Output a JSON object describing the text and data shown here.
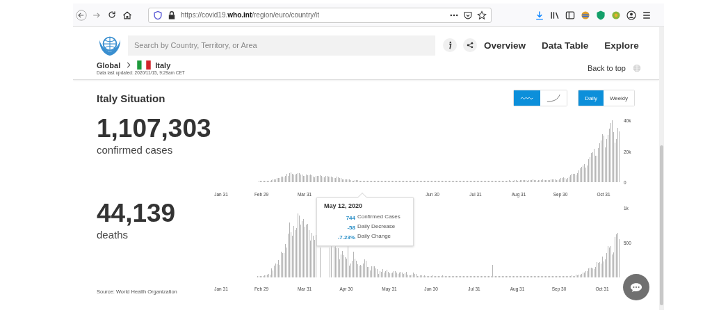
{
  "browser": {
    "url": "https://covid19.**who.int**/region/euro/country/it"
  },
  "header": {
    "search": {
      "placeholder": "Search by Country, Territory, or Area"
    },
    "nav": [
      {
        "label": "Overview"
      },
      {
        "label": "Data Table"
      },
      {
        "label": "Explore"
      }
    ],
    "breadcrumb": {
      "parent": "Global",
      "current": "Italy"
    },
    "updated": "Data last updated: 2020/11/15, 9:29am CET",
    "back_to_top": "Back to top"
  },
  "situation": {
    "title": "Italy Situation",
    "chart_type_toggle": [
      {
        "kind": "wave",
        "selected": true
      },
      {
        "kind": "curve",
        "selected": false
      }
    ],
    "period_toggle": [
      {
        "label": "Daily",
        "selected": true
      },
      {
        "label": "Weekly",
        "selected": false
      }
    ],
    "metrics": [
      {
        "value": "1,107,303",
        "label": "confirmed cases",
        "chart_data": {
          "type": "bar",
          "ylim": [
            0,
            40000
          ],
          "categories": [
            "Jan 31",
            null,
            null,
            null,
            null,
            null,
            null,
            null,
            null,
            null,
            null,
            null,
            null,
            null,
            null,
            null,
            null,
            null,
            null,
            null,
            null,
            null,
            null,
            null,
            null,
            null,
            null,
            null,
            null,
            "Feb 29",
            null,
            null,
            null,
            null,
            null,
            null,
            null,
            null,
            null,
            null,
            null,
            null,
            null,
            null,
            null,
            null,
            null,
            null,
            null,
            null,
            null,
            null,
            null,
            null,
            null,
            null,
            null,
            null,
            null,
            null,
            "Mar 31",
            null,
            null,
            null,
            null,
            null,
            null,
            null,
            null,
            null,
            null,
            null,
            null,
            null,
            null,
            null,
            null,
            null,
            null,
            null,
            null,
            null,
            null,
            null,
            null,
            null,
            null,
            null,
            null,
            null,
            null,
            null,
            null,
            null,
            null,
            null,
            null,
            null,
            null,
            null,
            null,
            null,
            null,
            null,
            null,
            null,
            null,
            null,
            null,
            null,
            null,
            null,
            null,
            null,
            null,
            null,
            null,
            null,
            null,
            null,
            null,
            null,
            null,
            null,
            null,
            null,
            null,
            null,
            null,
            null,
            null,
            null,
            null,
            null,
            null,
            null,
            null,
            null,
            null,
            null,
            null,
            null,
            null,
            null,
            null,
            null,
            null,
            null,
            null,
            null,
            null,
            null,
            "Jun 30",
            null,
            null,
            null,
            null,
            null,
            null,
            null,
            null,
            null,
            null,
            null,
            null,
            null,
            null,
            null,
            null,
            null,
            null,
            null,
            null,
            null,
            null,
            null,
            null,
            null,
            null,
            null,
            null,
            null,
            null,
            "Jul 31",
            null,
            null,
            null,
            null,
            null,
            null,
            null,
            null,
            null,
            null,
            null,
            null,
            null,
            null,
            null,
            null,
            null,
            null,
            null,
            null,
            null,
            null,
            null,
            null,
            null,
            null,
            null,
            null,
            null,
            null,
            "Aug 31",
            null,
            null,
            null,
            null,
            null,
            null,
            null,
            null,
            null,
            null,
            null,
            null,
            null,
            null,
            null,
            null,
            null,
            null,
            null,
            null,
            null,
            null,
            null,
            null,
            null,
            null,
            null,
            null,
            null,
            "Sep 30",
            null,
            null,
            null,
            null,
            null,
            null,
            null,
            null,
            null,
            null,
            null,
            null,
            null,
            null,
            null,
            null,
            null,
            null,
            null,
            null,
            null,
            null,
            null,
            null,
            null,
            null,
            null,
            null,
            null,
            null,
            "Oct 31",
            null,
            null,
            null,
            null,
            null,
            null,
            null,
            null,
            null,
            null,
            null
          ],
          "yticks": [
            {
              "value": 0,
              "label": "0"
            },
            {
              "value": 20000,
              "label": "20k"
            },
            {
              "value": 40000,
              "label": "40k"
            }
          ],
          "series": [
            {
              "color": "#b5b5b5",
              "values": [
                0,
                0,
                0,
                0,
                0,
                0,
                0,
                0,
                0,
                0,
                0,
                0,
                0,
                0,
                0,
                0,
                0,
                0,
                0,
                0,
                0,
                0,
                0,
                0,
                0,
                0,
                0,
                200,
                200,
                200,
                500,
                500,
                500,
                500,
                1000,
                1000,
                1500,
                2000,
                2000,
                2000,
                2500,
                2500,
                2500,
                3500,
                3500,
                3000,
                4000,
                5500,
                4000,
                6000,
                6500,
                5500,
                5000,
                5000,
                5500,
                6000,
                6000,
                5000,
                5000,
                4000,
                4000,
                5000,
                4500,
                4500,
                5000,
                4500,
                3500,
                3000,
                4000,
                4000,
                4000,
                4500,
                4000,
                3000,
                3000,
                4000,
                4000,
                3500,
                3500,
                3500,
                3000,
                2500,
                2500,
                3500,
                3000,
                2500,
                2500,
                2000,
                2000,
                2000,
                2000,
                2000,
                2000,
                1500,
                1000,
                1000,
                1500,
                1500,
                1500,
                1000,
                1000,
                1000,
                500,
                1000,
                1000,
                1000,
                1000,
                500,
                500,
                500,
                1000,
                500,
                500,
                500,
                500,
                500,
                500,
                500,
                500,
                500,
                500,
                500,
                200,
                200,
                200,
                500,
                500,
                200,
                200,
                200,
                200,
                200,
                500,
                200,
                500,
                200,
                200,
                500,
                200,
                500,
                200,
                200,
                200,
                200,
                200,
                200,
                200,
                200,
                200,
                200,
                200,
                200,
                200,
                200,
                200,
                200,
                200,
                200,
                200,
                200,
                200,
                200,
                200,
                200,
                200,
                200,
                200,
                200,
                200,
                200,
                200,
                200,
                200,
                200,
                200,
                200,
                200,
                200,
                200,
                200,
                200,
                500,
                500,
                500,
                200,
                200,
                200,
                500,
                500,
                500,
                500,
                500,
                200,
                500,
                500,
                500,
                500,
                500,
                500,
                500,
                500,
                1000,
                1000,
                1000,
                1000,
                1000,
                1000,
                1500,
                1000,
                1000,
                1000,
                1500,
                1500,
                1000,
                1000,
                1500,
                1500,
                1500,
                1500,
                1500,
                1000,
                1500,
                1500,
                1500,
                2000,
                1500,
                1500,
                1000,
                1500,
                1500,
                1500,
                2000,
                1500,
                1500,
                1500,
                1500,
                1500,
                2000,
                2000,
                2000,
                2000,
                1500,
                1500,
                2000,
                2500,
                2500,
                3000,
                2500,
                2000,
                2500,
                3500,
                4500,
                5500,
                5500,
                5500,
                4500,
                6000,
                7500,
                9000,
                10000,
                11000,
                11500,
                9500,
                11000,
                15000,
                16000,
                19000,
                19500,
                21500,
                17000,
                17000,
                22000,
                25000,
                27000,
                31000,
                30000,
                22500,
                28000,
                30500,
                34500,
                38000,
                40000,
                32500,
                25500,
                28000,
                35000,
                33000
              ]
            }
          ]
        }
      },
      {
        "value": "44,139",
        "label": "deaths",
        "chart_data": {
          "type": "bar",
          "ylim": [
            0,
            1000
          ],
          "categories": [
            "Jan 31",
            null,
            null,
            null,
            null,
            null,
            null,
            null,
            null,
            null,
            null,
            null,
            null,
            null,
            null,
            null,
            null,
            null,
            null,
            null,
            null,
            null,
            null,
            null,
            null,
            null,
            null,
            null,
            null,
            "Feb 29",
            null,
            null,
            null,
            null,
            null,
            null,
            null,
            null,
            null,
            null,
            null,
            null,
            null,
            null,
            null,
            null,
            null,
            null,
            null,
            null,
            null,
            null,
            null,
            null,
            null,
            null,
            null,
            null,
            null,
            null,
            "Mar 31",
            null,
            null,
            null,
            null,
            null,
            null,
            null,
            null,
            null,
            null,
            null,
            null,
            null,
            null,
            null,
            null,
            null,
            null,
            null,
            null,
            null,
            null,
            null,
            null,
            null,
            null,
            null,
            null,
            null,
            "Apr 30",
            null,
            null,
            null,
            null,
            null,
            null,
            null,
            null,
            null,
            null,
            null,
            null,
            null,
            null,
            null,
            null,
            null,
            null,
            null,
            null,
            null,
            null,
            null,
            null,
            null,
            null,
            null,
            null,
            null,
            null,
            "May 31",
            null,
            null,
            null,
            null,
            null,
            null,
            null,
            null,
            null,
            null,
            null,
            null,
            null,
            null,
            null,
            null,
            null,
            null,
            null,
            null,
            null,
            null,
            null,
            null,
            null,
            null,
            null,
            null,
            null,
            "Jun 30",
            null,
            null,
            null,
            null,
            null,
            null,
            null,
            null,
            null,
            null,
            null,
            null,
            null,
            null,
            null,
            null,
            null,
            null,
            null,
            null,
            null,
            null,
            null,
            null,
            null,
            null,
            null,
            null,
            null,
            null,
            "Jul 31",
            null,
            null,
            null,
            null,
            null,
            null,
            null,
            null,
            null,
            null,
            null,
            null,
            null,
            null,
            null,
            null,
            null,
            null,
            null,
            null,
            null,
            null,
            null,
            null,
            null,
            null,
            null,
            null,
            null,
            null,
            "Aug 31",
            null,
            null,
            null,
            null,
            null,
            null,
            null,
            null,
            null,
            null,
            null,
            null,
            null,
            null,
            null,
            null,
            null,
            null,
            null,
            null,
            null,
            null,
            null,
            null,
            null,
            null,
            null,
            null,
            null,
            "Sep 30",
            null,
            null,
            null,
            null,
            null,
            null,
            null,
            null,
            null,
            null,
            null,
            null,
            null,
            null,
            null,
            null,
            null,
            null,
            null,
            null,
            null,
            null,
            null,
            null,
            null,
            null,
            null,
            null,
            null,
            null,
            "Oct 31",
            null,
            null,
            null,
            null,
            null,
            null,
            null,
            null,
            null,
            null,
            null,
            null
          ],
          "yticks": [
            {
              "value": 500,
              "label": "500"
            },
            {
              "value": 1000,
              "label": "1k"
            }
          ],
          "series": [
            {
              "color": "#b5b5b5",
              "values": [
                0,
                0,
                0,
                0,
                0,
                0,
                0,
                0,
                0,
                0,
                0,
                0,
                0,
                0,
                0,
                0,
                0,
                0,
                0,
                0,
                0,
                0,
                0,
                0,
                0,
                0,
                10,
                10,
                10,
                10,
                10,
                30,
                30,
                40,
                50,
                40,
                130,
                100,
                170,
                200,
                190,
                250,
                180,
                370,
                350,
                350,
                480,
                430,
                630,
                790,
                650,
                600,
                740,
                680,
                710,
                920,
                890,
                760,
                810,
                840,
                730,
                760,
                770,
                680,
                530,
                640,
                600,
                540,
                610,
                null,
                null,
                430,
                null,
                null,
                null,
                null,
                null,
                null,
                430,
                450,
                null,
                440,
                460,
                420,
                420,
                260,
                330,
                380,
                320,
                290,
                270,
                470,
                170,
                200,
                240,
                370,
                270,
                240,
                190,
                170,
                180,
                170,
                200,
                260,
                240,
                150,
                150,
                100,
                160,
                160,
                160,
                130,
                120,
                50,
                90,
                80,
                120,
                70,
                90,
                110,
                80,
                60,
                60,
                70,
                90,
                90,
                70,
                50,
                70,
                80,
                70,
                50,
                60,
                80,
                40,
                30,
                30,
                40,
                70,
                50,
                50,
                20,
                20,
                30,
                30,
                10,
                30,
                20,
                20,
                20,
                10,
                20,
                30,
                20,
                20,
                20,
                10,
                10,
                10,
                30,
                10,
                20,
                10,
                10,
                10,
                10,
                20,
                20,
                10,
                10,
                10,
                10,
                10,
                20,
                10,
                10,
                10,
                10,
                10,
                10,
                10,
                10,
                10,
                10,
                10,
                10,
                10,
                10,
                10,
                10,
                10,
                10,
                10,
                10,
                10,
                180,
                10,
                10,
                10,
                10,
                10,
                10,
                10,
                10,
                10,
                10,
                10,
                10,
                10,
                10,
                10,
                10,
                10,
                10,
                10,
                10,
                10,
                10,
                10,
                10,
                10,
                10,
                20,
                10,
                10,
                10,
                10,
                20,
                20,
                10,
                20,
                20,
                20,
                20,
                20,
                20,
                20,
                20,
                20,
                20,
                10,
                20,
                20,
                20,
                20,
                20,
                20,
                20,
                20,
                20,
                20,
                20,
                30,
                20,
                20,
                40,
                30,
                40,
                40,
                50,
                70,
                70,
                90,
                90,
                130,
                140,
                140,
                130,
                120,
                150,
                220,
                210,
                220,
                200,
                300,
                230,
                260,
                350,
                450,
                430,
                450,
                330,
                360,
                580,
                620,
                640,
                550
              ]
            }
          ]
        }
      }
    ],
    "tooltip": {
      "date": "May 12, 2020",
      "rows": [
        {
          "value": "744",
          "label": "Confirmed Cases"
        },
        {
          "value": "-58",
          "label": "Daily Decrease"
        },
        {
          "value": "-7.23%",
          "label": "Daily Change"
        }
      ]
    },
    "source": "Source: World Health Organization"
  }
}
